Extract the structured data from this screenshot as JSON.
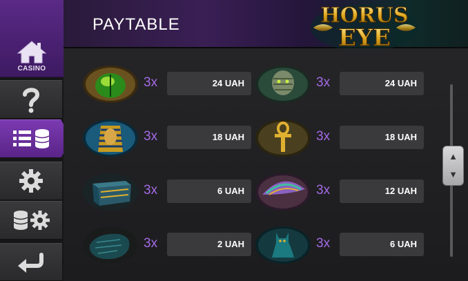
{
  "header": {
    "title": "PAYTABLE",
    "logo_text": [
      "HORUS",
      "EYE"
    ]
  },
  "sidebar": {
    "home_label": "CASINO",
    "items": [
      {
        "name": "help",
        "icon": "question-icon"
      },
      {
        "name": "paytable",
        "icon": "paytable-icon",
        "active": true
      },
      {
        "name": "settings",
        "icon": "gear-icon"
      },
      {
        "name": "bet-settings",
        "icon": "coins-gear-icon"
      },
      {
        "name": "back",
        "icon": "back-arrow-icon"
      }
    ]
  },
  "paytable": {
    "rows": [
      {
        "symbol": "green-scarab-icon",
        "mult": "3x",
        "payout": "24 UAH"
      },
      {
        "symbol": "mummy-icon",
        "mult": "3x",
        "payout": "24 UAH"
      },
      {
        "symbol": "pharaoh-mask-icon",
        "mult": "3x",
        "payout": "18 UAH"
      },
      {
        "symbol": "golden-ankh-icon",
        "mult": "3x",
        "payout": "18 UAH"
      },
      {
        "symbol": "treasure-chest-icon",
        "mult": "3x",
        "payout": "6 UAH"
      },
      {
        "symbol": "winged-scarab-icon",
        "mult": "3x",
        "payout": "12 UAH"
      },
      {
        "symbol": "stone-tablet-icon",
        "mult": "3x",
        "payout": "2 UAH"
      },
      {
        "symbol": "bastet-cat-icon",
        "mult": "3x",
        "payout": "6 UAH"
      }
    ]
  },
  "colors": {
    "accent": "#a56ae6",
    "sidebar_active": "#6a2e9e"
  }
}
